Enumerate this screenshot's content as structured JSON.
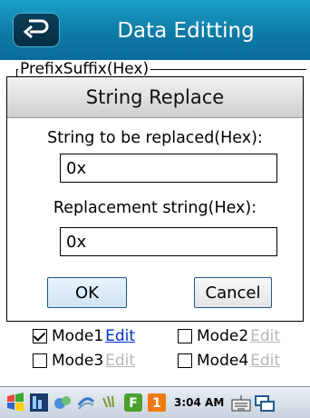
{
  "titlebar": {
    "title": "Data Editting",
    "back_icon": "back-arrow-icon"
  },
  "background": {
    "group_label": "PrefixSuffix(Hex)",
    "modes": [
      {
        "label": "Mode1",
        "edit": "Edit",
        "checked": true,
        "edit_enabled": true
      },
      {
        "label": "Mode2",
        "edit": "Edit",
        "checked": false,
        "edit_enabled": false
      },
      {
        "label": "Mode3",
        "edit": "Edit",
        "checked": false,
        "edit_enabled": false
      },
      {
        "label": "Mode4",
        "edit": "Edit",
        "checked": false,
        "edit_enabled": false
      }
    ]
  },
  "dialog": {
    "title": "String Replace",
    "find_label": "String to be replaced(Hex):",
    "find_value": "0x",
    "replace_label": "Replacement string(Hex):",
    "replace_value": "0x",
    "ok_label": "OK",
    "cancel_label": "Cancel"
  },
  "taskbar": {
    "time": "3:04 AM",
    "badge": "1",
    "icons": [
      "windows-flag-icon",
      "app-icon",
      "network-icon",
      "bluetooth-icon",
      "wifi-icon",
      "f-app-icon",
      "notification-badge-icon",
      "keyboard-icon",
      "window-switch-icon"
    ]
  },
  "colors": {
    "title_bar": "#0e7aa6",
    "link": "#0033cc",
    "disabled_link": "#b8b8b8",
    "ok_border": "#1e5a93"
  }
}
